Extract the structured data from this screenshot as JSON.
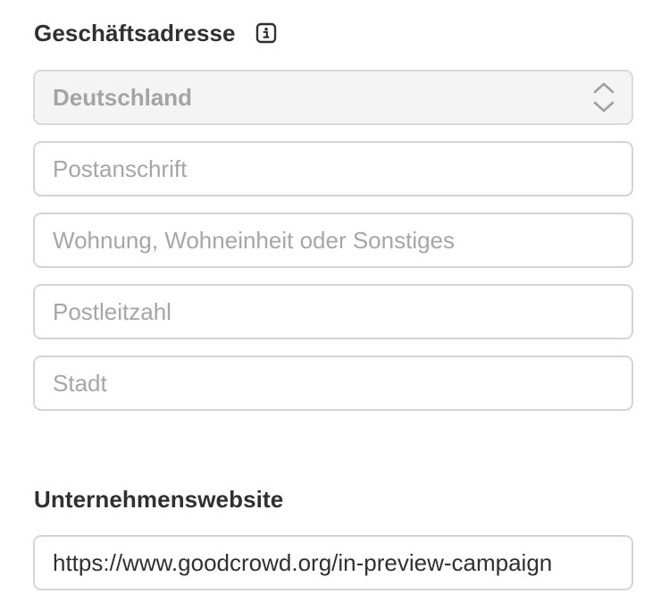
{
  "address": {
    "heading": "Geschäftsadresse",
    "info_icon": "info-icon",
    "country": {
      "selected": "Deutschland",
      "icon": "chevron-up-down-icon"
    },
    "street": {
      "placeholder": "Postanschrift",
      "value": ""
    },
    "apartment": {
      "placeholder": "Wohnung, Wohneinheit oder Sonstiges",
      "value": ""
    },
    "postal_code": {
      "placeholder": "Postleitzahl",
      "value": ""
    },
    "city": {
      "placeholder": "Stadt",
      "value": ""
    }
  },
  "website": {
    "heading": "Unternehmenswebsite",
    "value": "https://www.goodcrowd.org/in-preview-campaign"
  },
  "colors": {
    "text": "#303030",
    "placeholder": "#a6a6a6",
    "border": "#d4d4d4",
    "select_background": "#f4f4f4"
  }
}
